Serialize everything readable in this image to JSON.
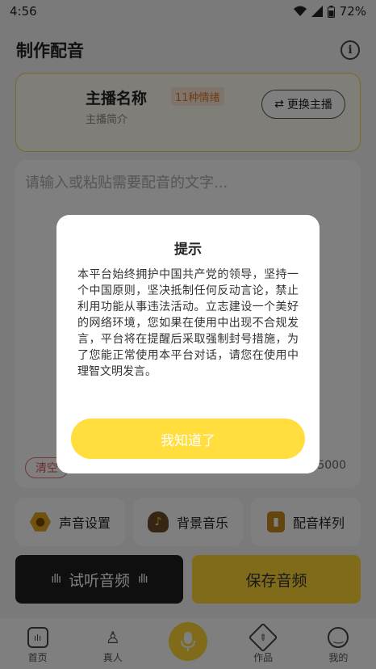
{
  "status_bar": {
    "time": "4:56",
    "battery": "72%"
  },
  "header": {
    "title": "制作配音"
  },
  "anchor": {
    "name": "主播名称",
    "badge": "11种情绪",
    "intro": "主播简介",
    "switch_label": "更换主播"
  },
  "editor": {
    "placeholder": "请输入或粘贴需要配音的文字...",
    "clear_label": "清空",
    "char_count": "5000"
  },
  "tools": [
    {
      "label": "声音设置",
      "icon": "hexagon-icon"
    },
    {
      "label": "背景音乐",
      "icon": "music-bag-icon"
    },
    {
      "label": "配音样列",
      "icon": "book-icon"
    }
  ],
  "actions": {
    "preview_label": "试听音频",
    "save_label": "保存音频"
  },
  "tabs": [
    {
      "label": "首页",
      "icon": "home-icon"
    },
    {
      "label": "真人",
      "icon": "tie-icon"
    },
    {
      "label": "",
      "icon": "microphone-icon"
    },
    {
      "label": "作品",
      "icon": "pen-ruler-icon"
    },
    {
      "label": "我的",
      "icon": "smile-icon"
    }
  ],
  "dialog": {
    "title": "提示",
    "body": "本平台始终拥护中国共产党的领导，坚持一个中国原则，坚决抵制任何反动言论，禁止利用功能从事违法活动。立志建设一个美好的网络环境，您如果在使用中出现不合规发言，平台将在提醒后采取强制封号措施，为了您能正常使用本平台对话，请您在使用中理智文明发言。",
    "ack_label": "我知道了"
  },
  "colors": {
    "accent": "#ffd733",
    "dark_button": "#1e1e1e",
    "badge_text": "#e07a2a"
  }
}
